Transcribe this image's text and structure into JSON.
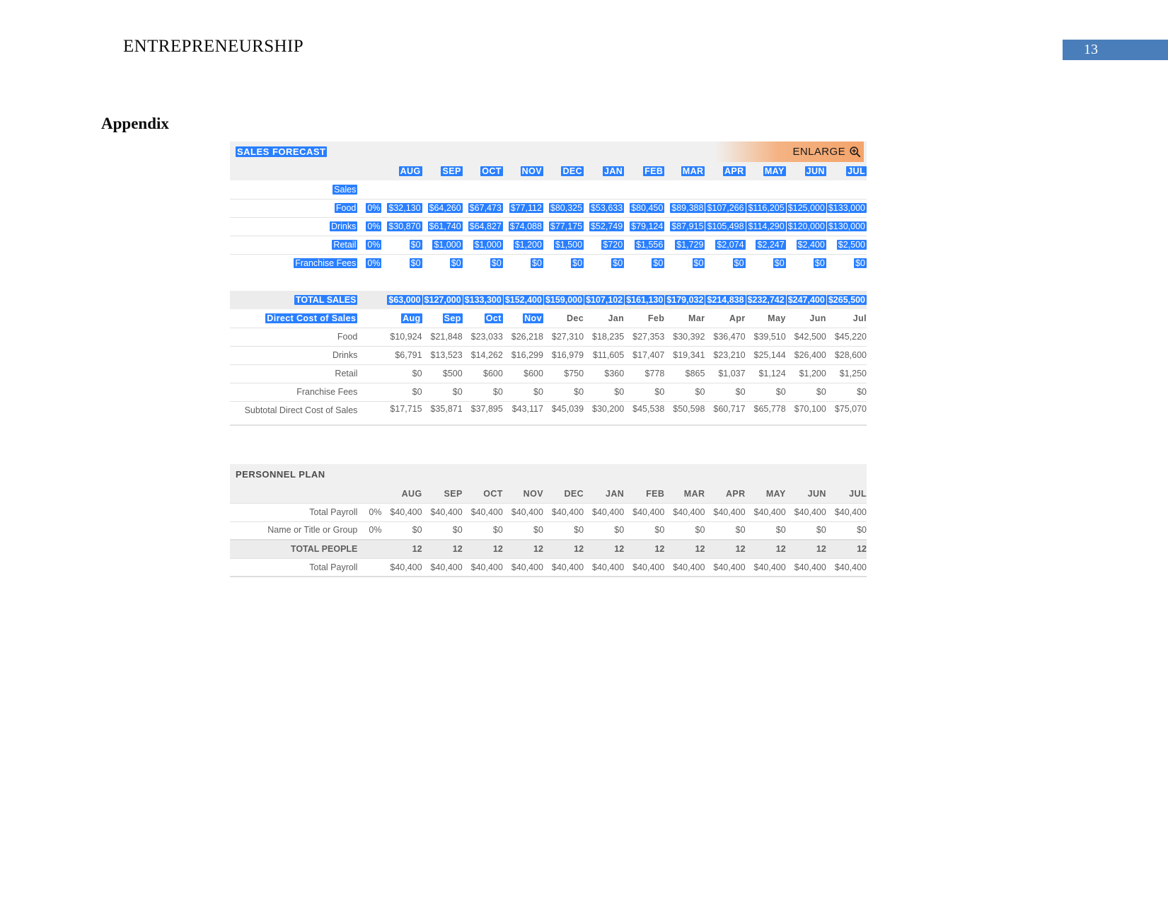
{
  "document": {
    "header_title": "ENTREPRENEURSHIP",
    "page_number": "13",
    "appendix_heading": "Appendix",
    "page_badge_color": "#4a7ebb"
  },
  "sales_forecast": {
    "title": "SALES FORECAST",
    "enlarge_label": "ENLARGE",
    "enlarge_icon": "magnifier-plus-icon",
    "months_upper": [
      "AUG",
      "SEP",
      "OCT",
      "NOV",
      "DEC",
      "JAN",
      "FEB",
      "MAR",
      "APR",
      "MAY",
      "JUN",
      "JUL"
    ],
    "months_title": [
      "Aug",
      "Sep",
      "Oct",
      "Nov",
      "Dec",
      "Jan",
      "Feb",
      "Mar",
      "Apr",
      "May",
      "Jun",
      "Jul"
    ],
    "section_sales_label": "Sales",
    "rows": [
      {
        "label": "Food",
        "growth": "0%",
        "values": [
          "$32,130",
          "$64,260",
          "$67,473",
          "$77,112",
          "$80,325",
          "$53,633",
          "$80,450",
          "$89,388",
          "$107,266",
          "$116,205",
          "$125,000",
          "$133,000"
        ]
      },
      {
        "label": "Drinks",
        "growth": "0%",
        "values": [
          "$30,870",
          "$61,740",
          "$64,827",
          "$74,088",
          "$77,175",
          "$52,749",
          "$79,124",
          "$87,915",
          "$105,498",
          "$114,290",
          "$120,000",
          "$130,000"
        ]
      },
      {
        "label": "Retail",
        "growth": "0%",
        "values": [
          "$0",
          "$1,000",
          "$1,000",
          "$1,200",
          "$1,500",
          "$720",
          "$1,556",
          "$1,729",
          "$2,074",
          "$2,247",
          "$2,400",
          "$2,500"
        ]
      },
      {
        "label": "Franchise Fees",
        "growth": "0%",
        "values": [
          "$0",
          "$0",
          "$0",
          "$0",
          "$0",
          "$0",
          "$0",
          "$0",
          "$0",
          "$0",
          "$0",
          "$0"
        ]
      }
    ],
    "total_sales": {
      "label": "TOTAL SALES",
      "values": [
        "$63,000",
        "$127,000",
        "$133,300",
        "$152,400",
        "$159,000",
        "$107,102",
        "$161,130",
        "$179,032",
        "$214,838",
        "$232,742",
        "$247,400",
        "$265,500"
      ]
    },
    "direct_cost": {
      "label": "Direct Cost of Sales",
      "rows": [
        {
          "label": "Food",
          "values": [
            "$10,924",
            "$21,848",
            "$23,033",
            "$26,218",
            "$27,310",
            "$18,235",
            "$27,353",
            "$30,392",
            "$36,470",
            "$39,510",
            "$42,500",
            "$45,220"
          ]
        },
        {
          "label": "Drinks",
          "values": [
            "$6,791",
            "$13,523",
            "$14,262",
            "$16,299",
            "$16,979",
            "$11,605",
            "$17,407",
            "$19,341",
            "$23,210",
            "$25,144",
            "$26,400",
            "$28,600"
          ]
        },
        {
          "label": "Retail",
          "values": [
            "$0",
            "$500",
            "$600",
            "$600",
            "$750",
            "$360",
            "$778",
            "$865",
            "$1,037",
            "$1,124",
            "$1,200",
            "$1,250"
          ]
        },
        {
          "label": "Franchise Fees",
          "values": [
            "$0",
            "$0",
            "$0",
            "$0",
            "$0",
            "$0",
            "$0",
            "$0",
            "$0",
            "$0",
            "$0",
            "$0"
          ]
        }
      ],
      "subtotal": {
        "label": "Subtotal Direct Cost of Sales",
        "values": [
          "$17,715",
          "$35,871",
          "$37,895",
          "$43,117",
          "$45,039",
          "$30,200",
          "$45,538",
          "$50,598",
          "$60,717",
          "$65,778",
          "$70,100",
          "$75,070"
        ]
      }
    }
  },
  "personnel_plan": {
    "title": "PERSONNEL PLAN",
    "months_upper": [
      "AUG",
      "SEP",
      "OCT",
      "NOV",
      "DEC",
      "JAN",
      "FEB",
      "MAR",
      "APR",
      "MAY",
      "JUN",
      "JUL"
    ],
    "rows": [
      {
        "label": "Total Payroll",
        "growth": "0%",
        "values": [
          "$40,400",
          "$40,400",
          "$40,400",
          "$40,400",
          "$40,400",
          "$40,400",
          "$40,400",
          "$40,400",
          "$40,400",
          "$40,400",
          "$40,400",
          "$40,400"
        ]
      },
      {
        "label": "Name or Title or Group",
        "growth": "0%",
        "values": [
          "$0",
          "$0",
          "$0",
          "$0",
          "$0",
          "$0",
          "$0",
          "$0",
          "$0",
          "$0",
          "$0",
          "$0"
        ]
      }
    ],
    "total_people": {
      "label": "TOTAL PEOPLE",
      "values": [
        "12",
        "12",
        "12",
        "12",
        "12",
        "12",
        "12",
        "12",
        "12",
        "12",
        "12",
        "12"
      ]
    },
    "total_payroll": {
      "label": "Total Payroll",
      "values": [
        "$40,400",
        "$40,400",
        "$40,400",
        "$40,400",
        "$40,400",
        "$40,400",
        "$40,400",
        "$40,400",
        "$40,400",
        "$40,400",
        "$40,400",
        "$40,400"
      ]
    }
  },
  "selection": {
    "note": "text-selection-highlight",
    "color": "#2a7fff"
  }
}
